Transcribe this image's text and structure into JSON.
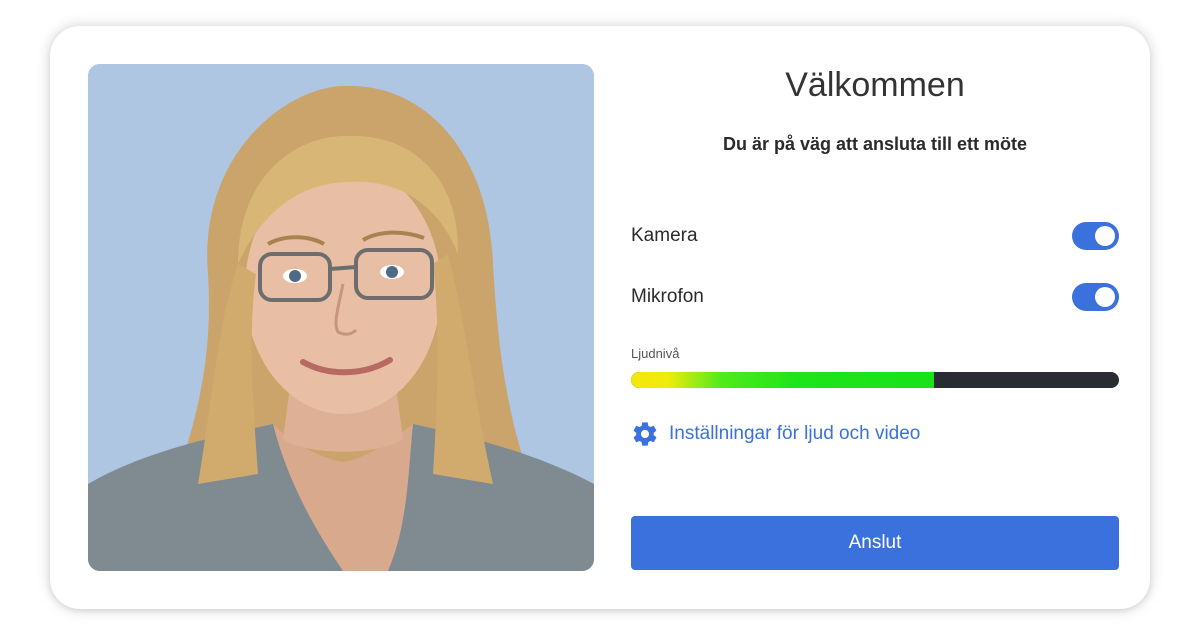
{
  "welcome": {
    "title": "Välkommen",
    "subtitle": "Du är på väg att ansluta till ett möte"
  },
  "camera": {
    "label": "Kamera",
    "enabled": true
  },
  "microphone": {
    "label": "Mikrofon",
    "enabled": true
  },
  "audio_level": {
    "label": "Ljudnivå",
    "fraction": 0.62
  },
  "settings": {
    "label": "Inställningar för ljud och video",
    "icon": "gear-icon"
  },
  "connect": {
    "label": "Anslut"
  },
  "colors": {
    "accent": "#3a71dc",
    "preview_background": "#aec6e1",
    "level_track": "#2a2c33",
    "level_low": "#f4e60c",
    "level_high": "#19e21a"
  }
}
